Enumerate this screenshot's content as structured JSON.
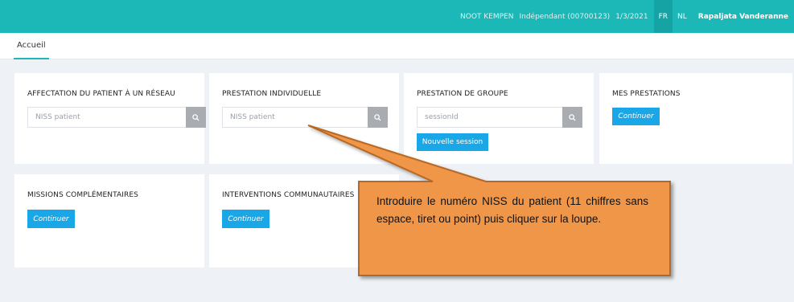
{
  "topbar": {
    "location": "NOOT KEMPEN",
    "status": "Indépendant (00700123)",
    "date": "1/3/2021",
    "lang_fr": "FR",
    "lang_nl": "NL",
    "user": "Rapaljata Vanderanne"
  },
  "tabs": [
    {
      "label": "Accueil"
    }
  ],
  "cards": {
    "affectation": {
      "title": "AFFECTATION DU PATIENT À UN RÉSEAU",
      "placeholder": "NISS patient"
    },
    "individuelle": {
      "title": "PRESTATION INDIVIDUELLE",
      "placeholder": "NISS patient"
    },
    "groupe": {
      "title": "PRESTATION DE GROUPE",
      "placeholder": "sessionId",
      "button": "Nouvelle session"
    },
    "mes_prestations": {
      "title": "MES PRESTATIONS",
      "button": "Continuer"
    },
    "missions": {
      "title": "MISSIONS COMPLÉMENTAIRES",
      "button": "Continuer"
    },
    "interventions": {
      "title": "INTERVENTIONS COMMUNAUTAIRES",
      "button": "Continuer"
    }
  },
  "callout": {
    "text": "Introduire le numéro NISS du patient (11 chiffres sans espace, tiret ou point) puis cliquer sur la loupe."
  },
  "colors": {
    "topbar": "#1cb8b8",
    "primary_button": "#1aa7e8",
    "search_button": "#a9adb2",
    "callout_fill": "#f0964a",
    "callout_border": "#b86820"
  },
  "icons": {
    "search": "search-icon"
  }
}
